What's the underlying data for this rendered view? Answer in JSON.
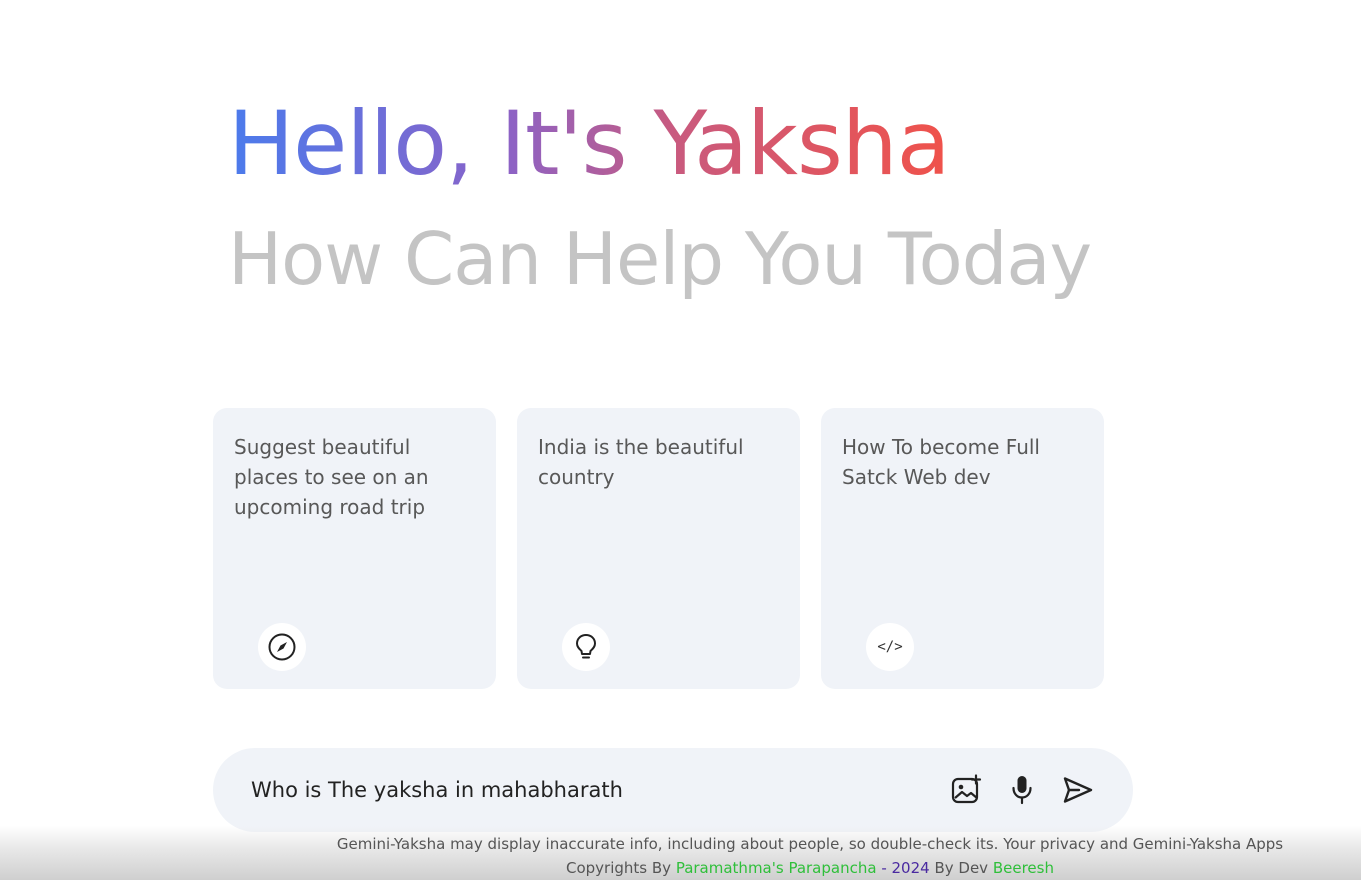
{
  "greeting": {
    "title": "Hello, It's Yaksha",
    "subtitle": "How Can Help You Today"
  },
  "cards": [
    {
      "text": "Suggest beautiful places to see on an upcoming road trip",
      "icon": "compass-icon"
    },
    {
      "text": "India is the beautiful country",
      "icon": "bulb-icon"
    },
    {
      "text": "How To become Full Satck Web dev",
      "icon": "code-icon",
      "glyph": "</>"
    }
  ],
  "prompt": {
    "value": "Who is The yaksha in mahabharath",
    "icons": [
      "gallery-icon",
      "mic-icon",
      "send-icon"
    ]
  },
  "footer": {
    "disclaimer": "Gemini-Yaksha may display inaccurate info, including about people, so double-check its. Your privacy and Gemini-Yaksha Apps",
    "copyright_prefix": "Copyrights By",
    "brand": "Paramathma's Parapancha",
    "year": "- 2024",
    "by": "By Dev",
    "author": "Beeresh"
  },
  "colors": {
    "gradient_start": "#4b7bec",
    "gradient_end": "#f0524a",
    "subtitle": "#c4c4c4",
    "card_bg": "#f0f3f8",
    "brand_green": "#2fbf3a",
    "year_purple": "#4a2aa0"
  }
}
